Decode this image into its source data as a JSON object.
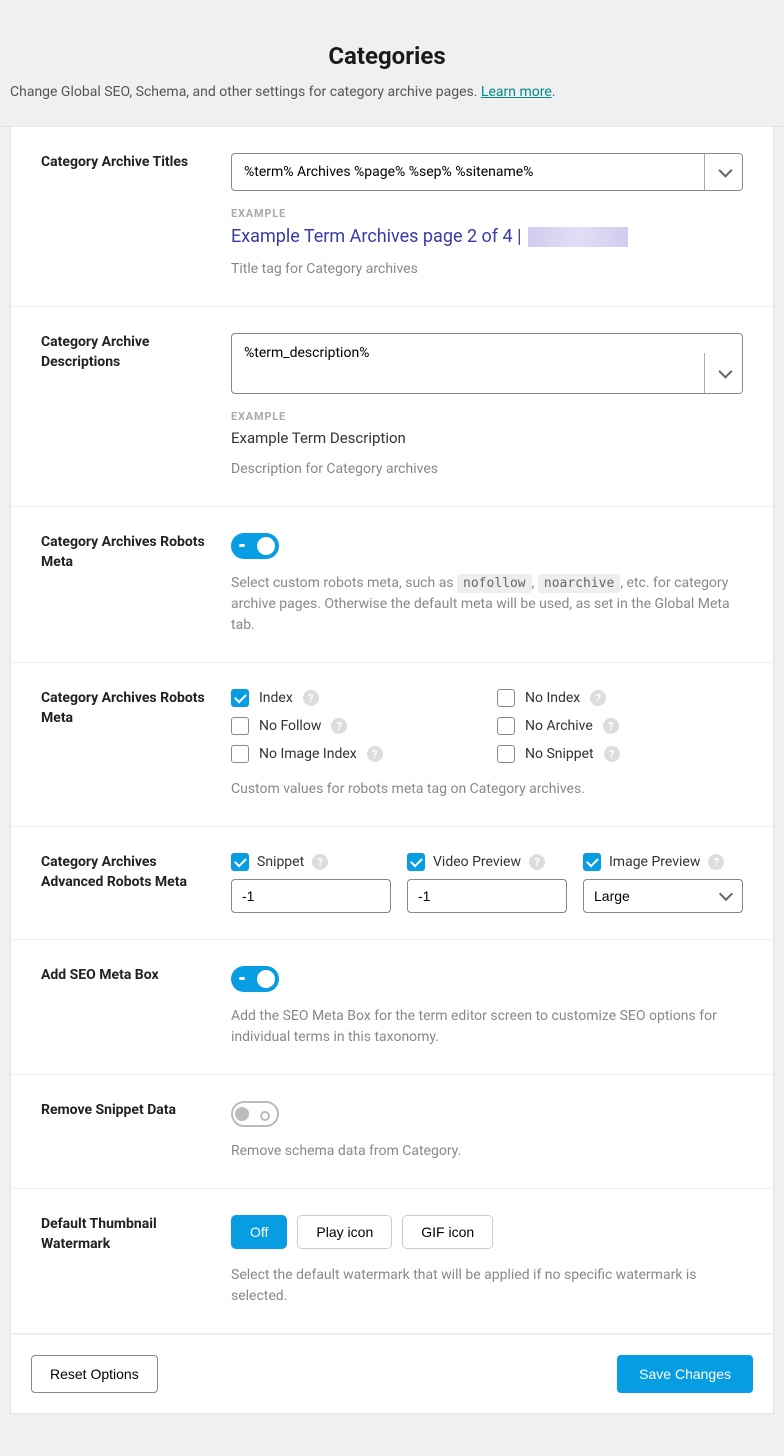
{
  "header": {
    "title": "Categories",
    "subtitle_pre": "Change Global SEO, Schema, and other settings for category archive pages. ",
    "learn_more": "Learn more",
    "subtitle_post": "."
  },
  "fields": {
    "archive_titles": {
      "label": "Category Archive Titles",
      "value": "%term% Archives %page% %sep% %sitename%",
      "example_label": "EXAMPLE",
      "example_preview": "Example Term Archives page 2 of 4 |",
      "desc": "Title tag for Category archives"
    },
    "archive_descriptions": {
      "label": "Category Archive Descriptions",
      "value": "%term_description%",
      "example_label": "EXAMPLE",
      "example_text": "Example Term Description",
      "desc": "Description for Category archives"
    },
    "robots_meta_toggle": {
      "label": "Category Archives Robots Meta",
      "desc_pre": "Select custom robots meta, such as ",
      "code1": "nofollow",
      "desc_mid": ", ",
      "code2": "noarchive",
      "desc_post": ", etc. for category archive pages. Otherwise the default meta will be used, as set in the Global Meta tab."
    },
    "robots_checkboxes": {
      "label": "Category Archives Robots Meta",
      "items": [
        {
          "label": "Index",
          "checked": true,
          "help": true
        },
        {
          "label": "No Index",
          "checked": false,
          "help": true
        },
        {
          "label": "No Follow",
          "checked": false,
          "help": true
        },
        {
          "label": "No Archive",
          "checked": false,
          "help": true
        },
        {
          "label": "No Image Index",
          "checked": false,
          "help": true
        },
        {
          "label": "No Snippet",
          "checked": false,
          "help": true
        }
      ],
      "desc": "Custom values for robots meta tag on Category archives."
    },
    "adv_robots": {
      "label": "Category Archives Advanced Robots Meta",
      "cols": [
        {
          "label": "Snippet",
          "value": "-1",
          "type": "input"
        },
        {
          "label": "Video Preview",
          "value": "-1",
          "type": "input"
        },
        {
          "label": "Image Preview",
          "value": "Large",
          "type": "select"
        }
      ]
    },
    "seo_meta_box": {
      "label": "Add SEO Meta Box",
      "desc": "Add the SEO Meta Box for the term editor screen to customize SEO options for individual terms in this taxonomy."
    },
    "remove_snippet": {
      "label": "Remove Snippet Data",
      "desc": "Remove schema data from Category."
    },
    "watermark": {
      "label": "Default Thumbnail Watermark",
      "options": [
        "Off",
        "Play icon",
        "GIF icon"
      ],
      "active": 0,
      "desc": "Select the default watermark that will be applied if no specific watermark is selected."
    }
  },
  "footer": {
    "reset": "Reset Options",
    "save": "Save Changes"
  }
}
